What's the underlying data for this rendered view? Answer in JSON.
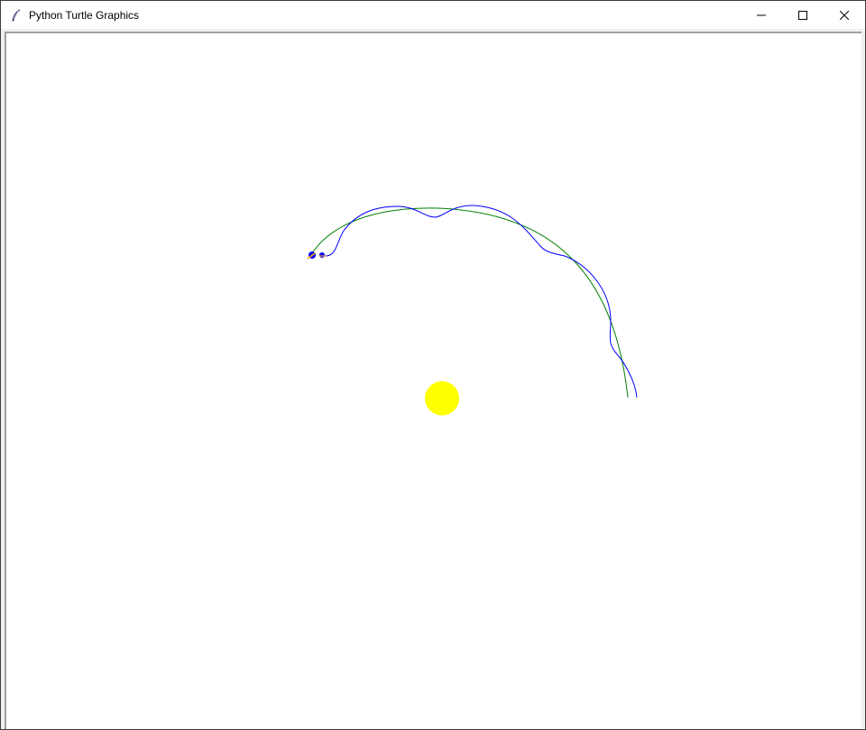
{
  "window": {
    "title": "Python Turtle Graphics",
    "controls": {
      "minimize": "minimize-icon",
      "maximize": "maximize-icon",
      "close": "close-icon"
    },
    "app_icon": "feather-icon"
  },
  "canvas": {
    "background": "#ffffff"
  },
  "colors": {
    "sun": "#ffff00",
    "planet_orbit": "#008000",
    "moon_orbit": "#0000ff",
    "turtle_fill": "#0000ff",
    "turtle_outline": "#ffa500"
  }
}
